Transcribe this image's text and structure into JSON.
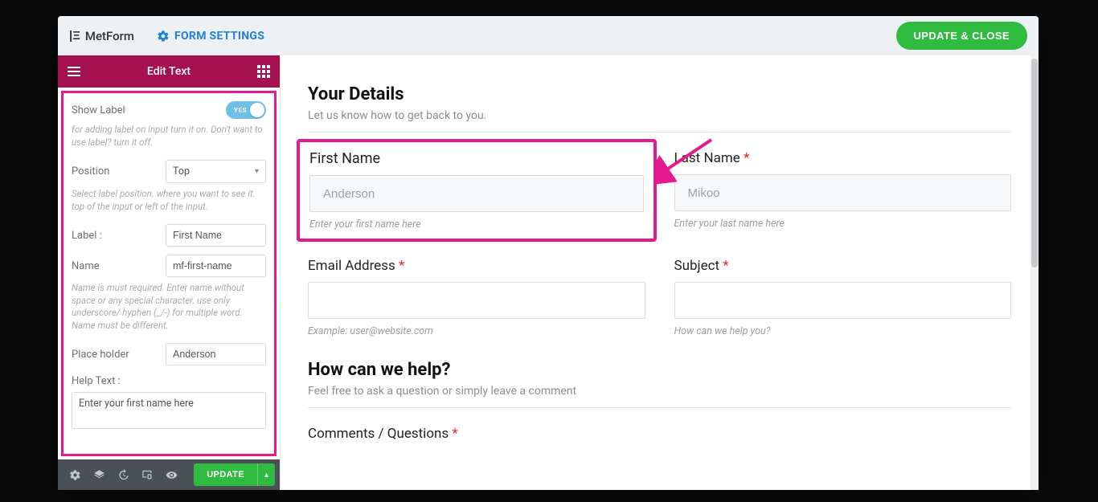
{
  "header": {
    "brand": "MetForm",
    "form_settings_label": "FORM SETTINGS",
    "update_close_label": "UPDATE & CLOSE"
  },
  "sidebar": {
    "title": "Edit Text",
    "show_label": {
      "label": "Show Label",
      "state_text": "YES",
      "desc": "for adding label on input turn it on. Don't want to use label? turn it off."
    },
    "position": {
      "label": "Position",
      "value": "Top",
      "desc": "Select label position. where you want to see it. top of the input or left of the input."
    },
    "label_field": {
      "label": "Label :",
      "value": "First Name"
    },
    "name_field": {
      "label": "Name",
      "value": "mf-first-name",
      "desc": "Name is must required. Enter name without space or any special character. use only underscore/ hyphen (_/-) for multiple word. Name must be different."
    },
    "placeholder_field": {
      "label": "Place holder",
      "value": "Anderson"
    },
    "helptext_field": {
      "label": "Help Text :",
      "value": "Enter your first name here"
    },
    "bottom_update": "UPDATE"
  },
  "preview": {
    "section1": {
      "title": "Your Details",
      "sub": "Let us know how to get back to you."
    },
    "first_name": {
      "label": "First Name",
      "placeholder": "Anderson",
      "help": "Enter your first name here"
    },
    "last_name": {
      "label": "Last Name",
      "placeholder": "Mikoo",
      "help": "Enter your last name here"
    },
    "email": {
      "label": "Email Address",
      "help": "Example: user@website.com"
    },
    "subject": {
      "label": "Subject",
      "help": "How can we help you?"
    },
    "section2": {
      "title": "How can we help?",
      "sub": "Feel free to ask a question or simply leave a comment"
    },
    "comments": {
      "label": "Comments / Questions"
    }
  }
}
